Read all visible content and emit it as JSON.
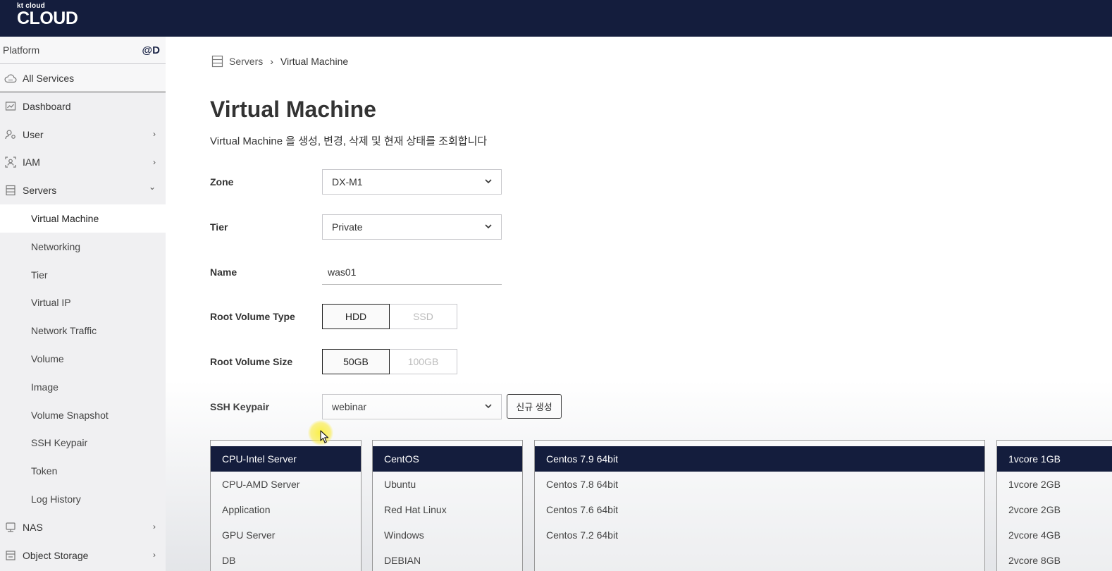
{
  "app": {
    "logo_small": "kt cloud",
    "logo_big": "CLOUD",
    "brand_color": "#141d3d"
  },
  "sidebar": {
    "platform_label": "Platform",
    "platform_user": "@D",
    "all_services": "All Services",
    "items": [
      {
        "label": "Dashboard",
        "icon": "dashboard-icon"
      },
      {
        "label": "User",
        "icon": "user-gear-icon",
        "chevron": "›"
      },
      {
        "label": "IAM",
        "icon": "iam-icon",
        "chevron": "›"
      },
      {
        "label": "Servers",
        "icon": "servers-icon",
        "chevron": "⌄"
      }
    ],
    "server_subitems": [
      "Virtual Machine",
      "Networking",
      "Tier",
      "Virtual IP",
      "Network Traffic",
      "Volume",
      "Image",
      "Volume Snapshot",
      "SSH Keypair",
      "Token",
      "Log History"
    ],
    "bottom_items": [
      {
        "label": "NAS",
        "icon": "nas-icon",
        "chevron": "›"
      },
      {
        "label": "Object Storage",
        "icon": "object-storage-icon",
        "chevron": "›"
      }
    ]
  },
  "breadcrumb": {
    "parent": "Servers",
    "separator": "›",
    "current": "Virtual Machine"
  },
  "page": {
    "title": "Virtual Machine",
    "description": "Virtual Machine 을 생성, 변경, 삭제 및 현재 상태를 조회합니다"
  },
  "form": {
    "zone": {
      "label": "Zone",
      "value": "DX-M1"
    },
    "tier": {
      "label": "Tier",
      "value": "Private"
    },
    "name": {
      "label": "Name",
      "value": "was01"
    },
    "root_volume_type": {
      "label": "Root Volume Type",
      "options": [
        "HDD",
        "SSD"
      ],
      "selected": "HDD"
    },
    "root_volume_size": {
      "label": "Root Volume Size",
      "options": [
        "50GB",
        "100GB"
      ],
      "selected": "50GB"
    },
    "ssh_keypair": {
      "label": "SSH Keypair",
      "value": "webinar",
      "new_button": "신규 생성"
    }
  },
  "lists": {
    "server_type": [
      "CPU-Intel Server",
      "CPU-AMD Server",
      "Application",
      "GPU Server",
      "DB"
    ],
    "os": [
      "CentOS",
      "Ubuntu",
      "Red Hat Linux",
      "Windows",
      "DEBIAN"
    ],
    "os_version": [
      "Centos 7.9 64bit",
      "Centos 7.8 64bit",
      "Centos 7.6 64bit",
      "Centos 7.2 64bit"
    ],
    "spec": [
      "1vcore 1GB",
      "1vcore 2GB",
      "2vcore 2GB",
      "2vcore 4GB",
      "2vcore 8GB"
    ]
  }
}
